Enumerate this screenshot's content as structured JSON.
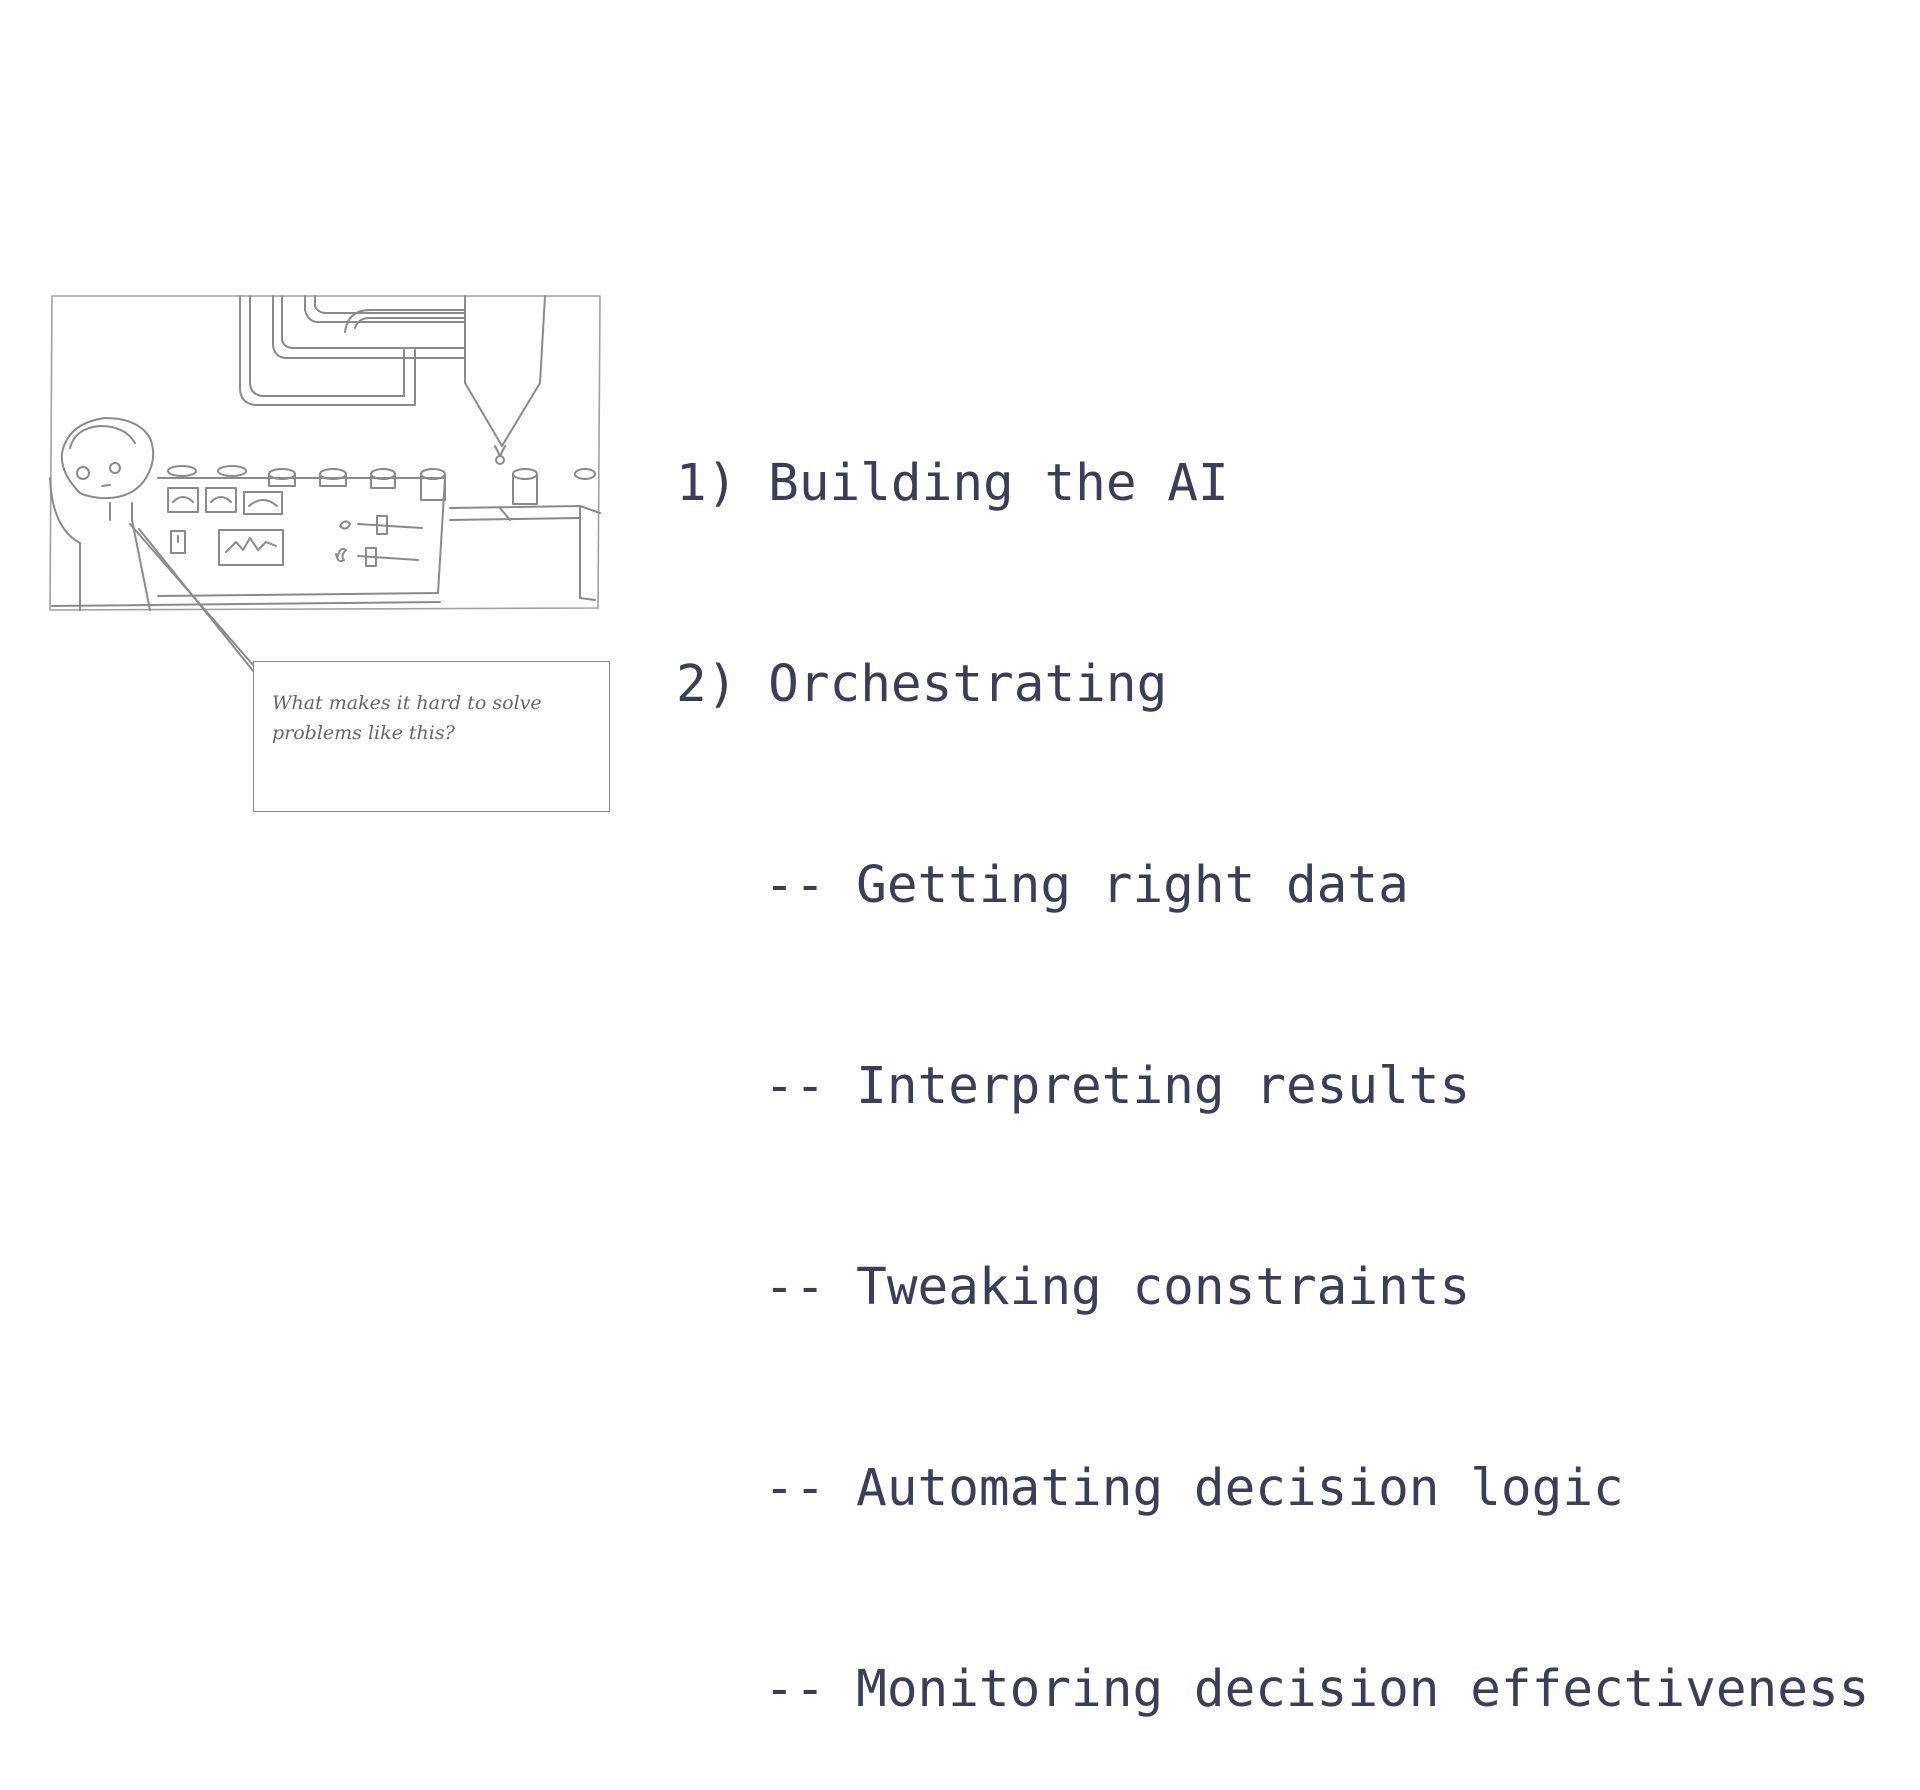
{
  "illustration": {
    "name": "control-room-sketch",
    "stroke_color": "#8a8a8a"
  },
  "callout": {
    "text": "What makes it hard to solve problems like this?"
  },
  "list": {
    "items": [
      "1) Building the AI",
      "2) Orchestrating"
    ],
    "subitems": [
      "-- Getting right data",
      "-- Interpreting results",
      "-- Tweaking constraints",
      "-- Automating decision logic",
      "-- Monitoring decision effectiveness"
    ]
  },
  "colors": {
    "text": "#3b3d5c",
    "callout_text": "#666666",
    "background": "#ffffff"
  }
}
